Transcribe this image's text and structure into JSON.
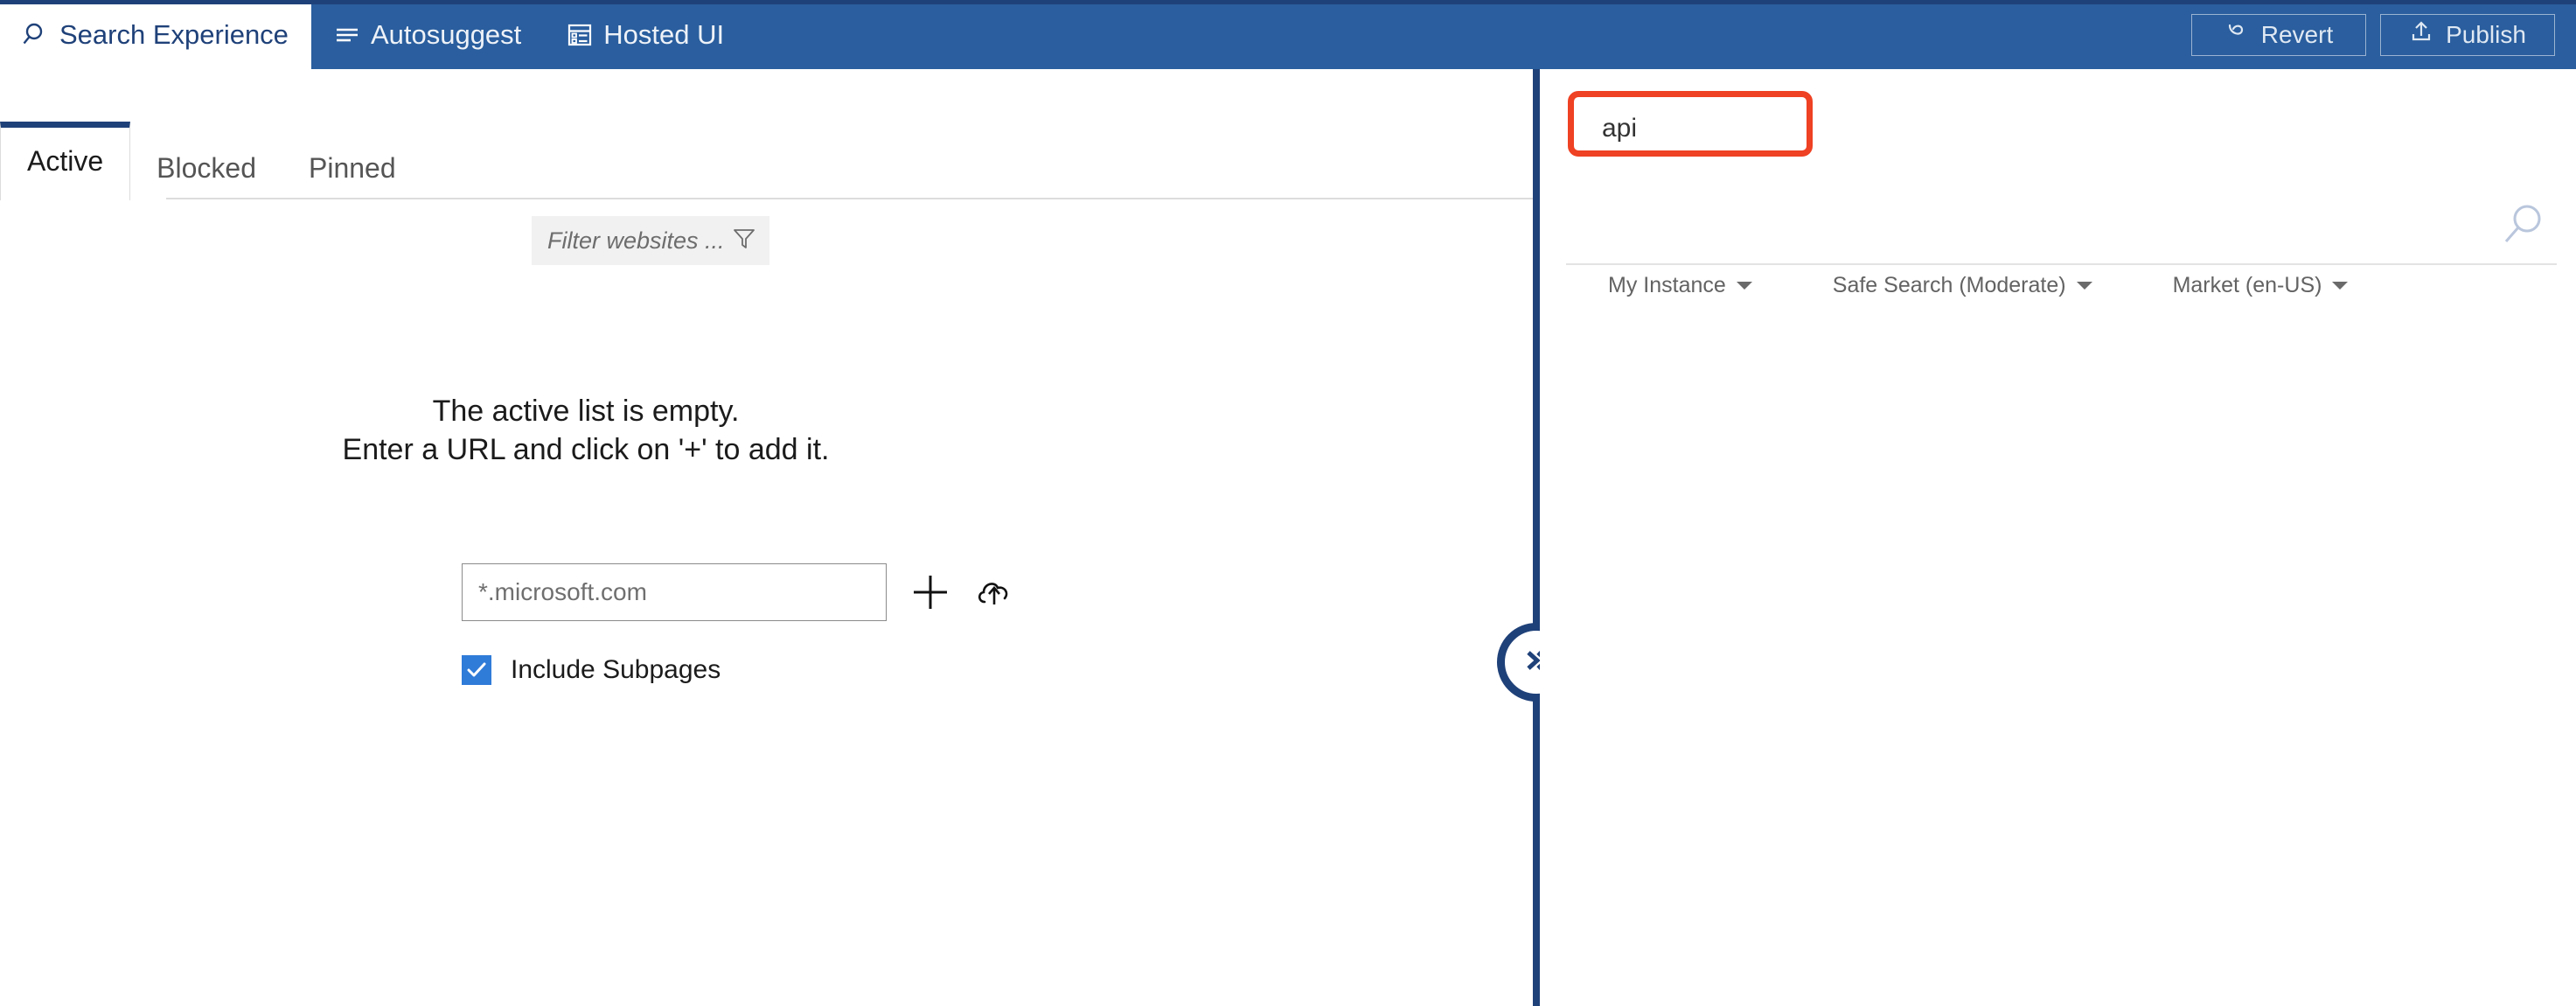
{
  "topbar": {
    "nav_items": [
      {
        "label": "Search Experience",
        "icon": "search-icon",
        "active": true
      },
      {
        "label": "Autosuggest",
        "icon": "list-lines-icon",
        "active": false
      },
      {
        "label": "Hosted UI",
        "icon": "layout-panel-icon",
        "active": false
      }
    ],
    "actions": [
      {
        "label": "Revert",
        "icon": "undo-arrow-icon"
      },
      {
        "label": "Publish",
        "icon": "upload-arrow-icon"
      }
    ],
    "background_color": "#2a5e9e",
    "accent_color": "#1f4179"
  },
  "left_panel": {
    "tabs": [
      {
        "label": "Active",
        "selected": true
      },
      {
        "label": "Blocked",
        "selected": false
      },
      {
        "label": "Pinned",
        "selected": false
      }
    ],
    "filter": {
      "placeholder": "Filter websites ...",
      "value": "",
      "icon": "funnel-icon"
    },
    "empty_state": {
      "line1": "The active list is empty.",
      "line2": "Enter a URL and click on '+' to add it."
    },
    "url_input": {
      "placeholder": "*.microsoft.com",
      "value": ""
    },
    "add_icon": "plus-icon",
    "upload_icon": "cloud-upload-icon",
    "include_subpages": {
      "label": "Include Subpages",
      "checked": true,
      "color": "#2f7bd8"
    }
  },
  "divider": {
    "collapse_icon": "double-chevron-right-icon",
    "color": "#1f4179"
  },
  "right_panel": {
    "search": {
      "value": "api",
      "highlight_color": "#ef4123",
      "magnifier_icon": "search-icon"
    },
    "options": [
      {
        "label": "My Instance",
        "caret": true
      },
      {
        "label": "Safe Search (Moderate)",
        "caret": true
      },
      {
        "label": "Market (en-US)",
        "caret": true
      }
    ]
  }
}
